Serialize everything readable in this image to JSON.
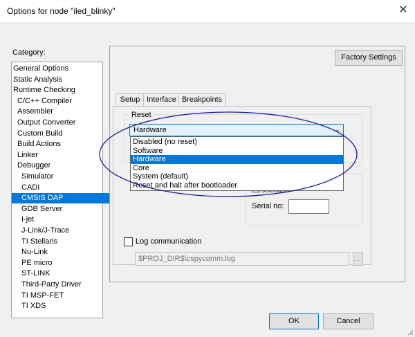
{
  "window": {
    "title": "Options for node \"iled_blinky\"",
    "close_glyph": "✕"
  },
  "category": {
    "label": "Category:",
    "items": [
      "General Options",
      "Static Analysis",
      "Runtime Checking",
      "C/C++ Compiler",
      "Assembler",
      "Output Converter",
      "Custom Build",
      "Build Actions",
      "Linker",
      "Debugger",
      "Simulator",
      "CADI",
      "CMSIS DAP",
      "GDB Server",
      "I-jet",
      "J-Link/J-Trace",
      "TI Stellaris",
      "Nu-Link",
      "PE micro",
      "ST-LINK",
      "Third-Party Driver",
      "TI MSP-FET",
      "TI XDS"
    ],
    "selected": "CMSIS DAP"
  },
  "factory_settings": "Factory Settings",
  "tabs": [
    "Setup",
    "Interface",
    "Breakpoints"
  ],
  "reset": {
    "label": "Reset",
    "value": "Hardware",
    "options": [
      "Disabled (no reset)",
      "Software",
      "Hardware",
      "Core",
      "System (default)",
      "Reset and halt after bootloader"
    ],
    "selected": "Hardware"
  },
  "probe": {
    "selection_text": "selection",
    "serial_label": "Serial no:",
    "serial_value": ""
  },
  "log": {
    "label": "Log communication",
    "checked": false,
    "path": "$PROJ_DIR$\\cspycomm.log",
    "browse": "..."
  },
  "buttons": {
    "ok": "OK",
    "cancel": "Cancel"
  },
  "colors": {
    "selection": "#0078d7",
    "annotation_ellipse": "#1a1aa6"
  }
}
